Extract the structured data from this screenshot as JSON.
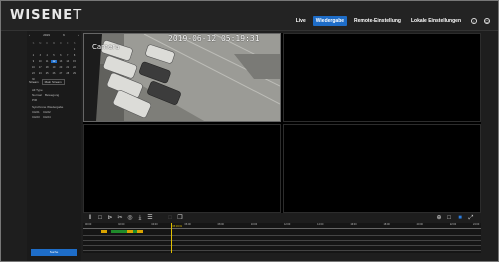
{
  "brand": {
    "logo_bold": "WISENE",
    "logo_thin": "T"
  },
  "nav": {
    "items": [
      "Live",
      "Wiedergabe",
      "Remote-Einstellung",
      "Lokale Einstellungen"
    ],
    "active_index": 1,
    "icons": [
      "info-icon",
      "power-icon"
    ]
  },
  "calendar": {
    "prev": "‹",
    "year": "2019",
    "month": "6",
    "next": "›",
    "weekdays": [
      "S",
      "M",
      "D",
      "M",
      "D",
      "F",
      "S"
    ],
    "days": [
      "",
      "",
      "",
      "",
      "",
      "",
      "1",
      "2",
      "3",
      "4",
      "5",
      "6",
      "7",
      "8",
      "9",
      "10",
      "11",
      "12",
      "13",
      "14",
      "15",
      "16",
      "17",
      "18",
      "19",
      "20",
      "21",
      "22",
      "23",
      "24",
      "25",
      "26",
      "27",
      "28",
      "29",
      "30",
      "",
      "",
      "",
      "",
      "",
      ""
    ],
    "selected_day": "12"
  },
  "filters": {
    "stream": "Stream",
    "type": "Main Stream"
  },
  "record_types": [
    "All Type",
    "Normal",
    "Bewegung",
    "PIR"
  ],
  "sync": {
    "label": "Synchrone Wiedergabe",
    "channels": [
      "CH01",
      "CH02",
      "CH03",
      "CH04"
    ]
  },
  "search_button": "Suche",
  "video": {
    "timestamp": "2019-06-12 05:19:31",
    "camera_name": "Camera"
  },
  "toolbar": {
    "left_icons": [
      "pause-icon",
      "stop-icon",
      "frame-icon",
      "clip-icon",
      "snapshot-icon",
      "download-icon",
      "list-icon",
      "lock-icon",
      "copy-icon"
    ],
    "right_icons": [
      "zoom-icon",
      "single-view-icon",
      "quad-view-icon",
      "fullscreen-icon"
    ]
  },
  "timeline": {
    "hours": [
      "00:00",
      "02:00",
      "04:00",
      "06:00",
      "08:00",
      "10:00",
      "12:00",
      "14:00",
      "16:00",
      "18:00",
      "20:00",
      "22:00",
      "24:00"
    ],
    "cursor_label": "05:19:31",
    "cursor_fraction": 0.222,
    "segments": [
      {
        "start_fraction": 0.045,
        "end_fraction": 0.06,
        "color": "#d9a400"
      },
      {
        "start_fraction": 0.07,
        "end_fraction": 0.135,
        "color": "#1f8b2a"
      },
      {
        "start_fraction": 0.11,
        "end_fraction": 0.125,
        "color": "#d9a400"
      },
      {
        "start_fraction": 0.135,
        "end_fraction": 0.15,
        "color": "#d9a400"
      }
    ]
  },
  "colors": {
    "accent": "#1e6dc8",
    "recording_normal": "#1f8b2a",
    "recording_event": "#d9a400",
    "cursor": "#e0c000"
  }
}
